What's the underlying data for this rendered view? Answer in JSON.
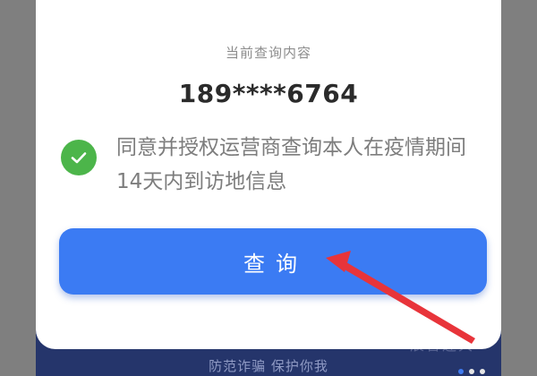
{
  "dialog": {
    "caption": "当前查询内容",
    "phone_number": "189****6764",
    "consent_text": "同意并授权运营商查询本人在疫情期间14天内到访地信息",
    "consent_checked": true,
    "query_button_label": "查询"
  },
  "footer": {
    "slogan": "防范诈骗 保护你我",
    "faded_label": "辰言连大"
  },
  "colors": {
    "accent_blue": "#3b7bf3",
    "check_green": "#4cb54a",
    "annotation_arrow": "#e8343a",
    "footer_navy": "#25356b"
  },
  "icons": {
    "consent_check": "check-circle-icon",
    "annotation": "red-arrow-annotation"
  }
}
